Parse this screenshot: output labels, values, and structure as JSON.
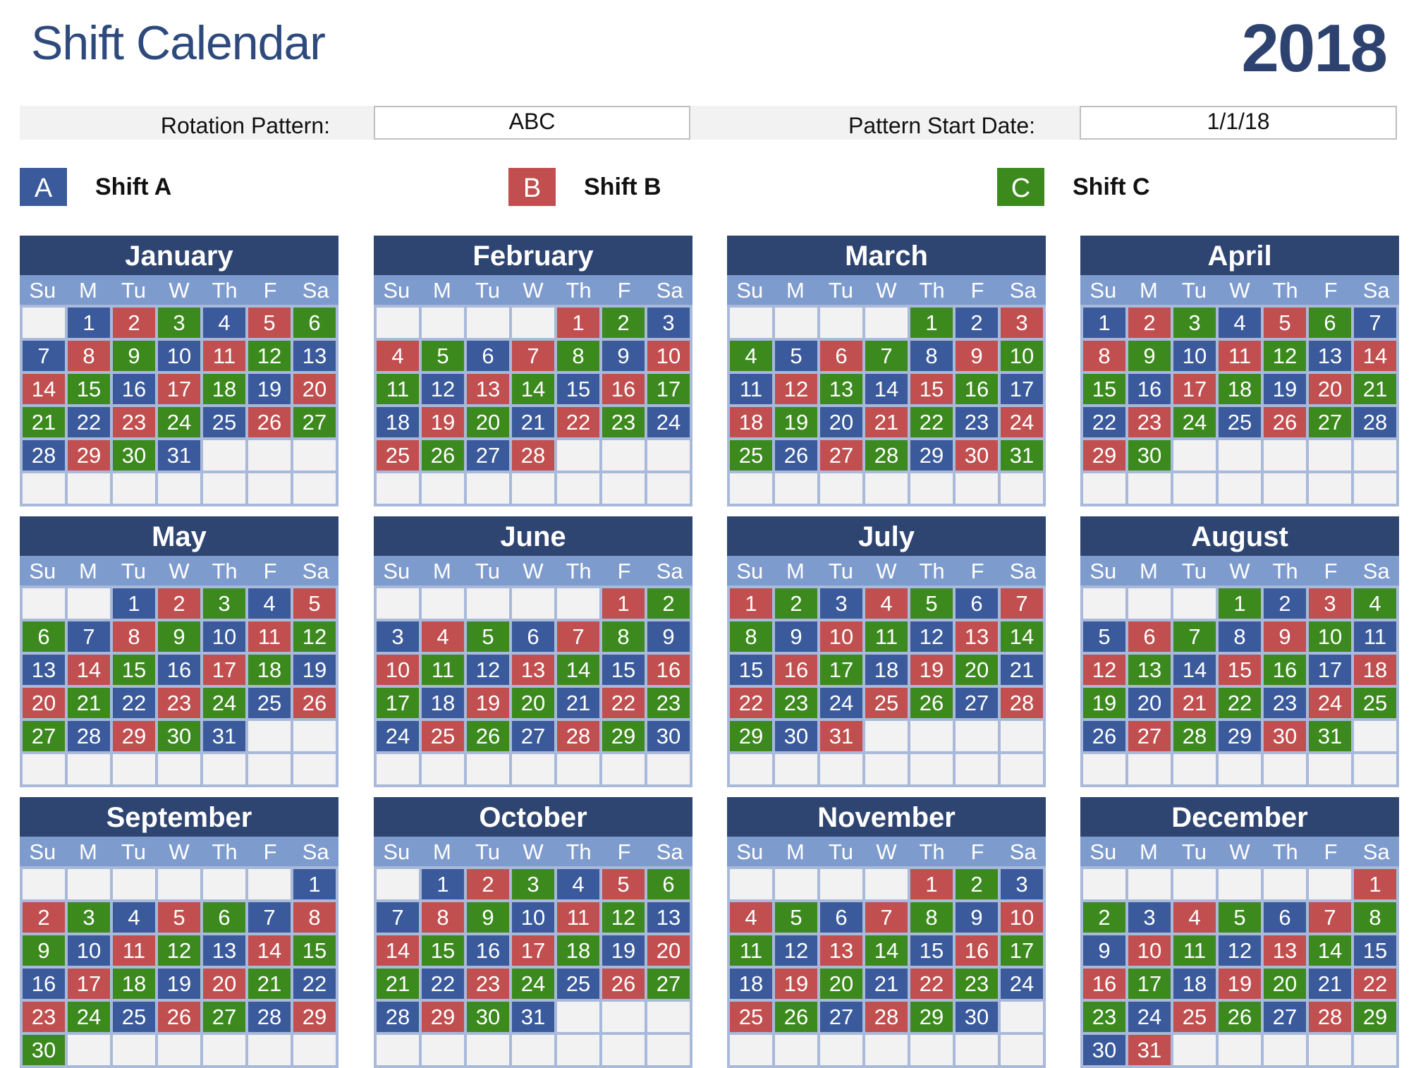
{
  "header": {
    "title": "Shift Calendar",
    "year": "2018"
  },
  "settings": {
    "rotation_label": "Rotation Pattern:",
    "rotation_value": "ABC",
    "start_label": "Pattern Start Date:",
    "start_value": "1/1/18"
  },
  "legend": [
    {
      "code": "A",
      "label": "Shift A",
      "color": "#3a5a9b"
    },
    {
      "code": "B",
      "label": "Shift B",
      "color": "#c14f4f"
    },
    {
      "code": "C",
      "label": "Shift C",
      "color": "#3c891e"
    }
  ],
  "weekdays": [
    "Su",
    "M",
    "Tu",
    "W",
    "Th",
    "F",
    "Sa"
  ],
  "months": [
    {
      "name": "January",
      "first_weekday": 1,
      "days": 31,
      "shifts": "ABCABCABCABCABCABCABCABCABCABCA"
    },
    {
      "name": "February",
      "first_weekday": 4,
      "days": 28,
      "shifts": "BCABCABCABCABCABCABCABCABCABC"
    },
    {
      "name": "March",
      "first_weekday": 4,
      "days": 31,
      "shifts": "CABCABCABCABCABCABCABCABCABCABC"
    },
    {
      "name": "April",
      "first_weekday": 0,
      "days": 30,
      "shifts": "ABCABCABCABCABCABCABCABCABCABC"
    },
    {
      "name": "May",
      "first_weekday": 2,
      "days": 31,
      "shifts": "ABCABCABCABCABCABCABCABCABCABCA"
    },
    {
      "name": "June",
      "first_weekday": 5,
      "days": 30,
      "shifts": "BCABCABCABCABCABCABCABCABCABCA"
    },
    {
      "name": "July",
      "first_weekday": 0,
      "days": 31,
      "shifts": "BCABCABCABCABCABCABCABCABCABCAB"
    },
    {
      "name": "August",
      "first_weekday": 3,
      "days": 31,
      "shifts": "CABCABCABCABCABCABCABCABCABCABC"
    },
    {
      "name": "September",
      "first_weekday": 6,
      "days": 30,
      "shifts": "ABCABCABCABCABCABCABCABCABCABC"
    },
    {
      "name": "October",
      "first_weekday": 1,
      "days": 31,
      "shifts": "ABCABCABCABCABCABCABCABCABCABCA"
    },
    {
      "name": "November",
      "first_weekday": 4,
      "days": 30,
      "shifts": "BCABCABCABCABCABCABCABCABCABCA"
    },
    {
      "name": "December",
      "first_weekday": 6,
      "days": 31,
      "shifts": "BCABCABCABCABCABCABCABCABCABCAB"
    }
  ]
}
